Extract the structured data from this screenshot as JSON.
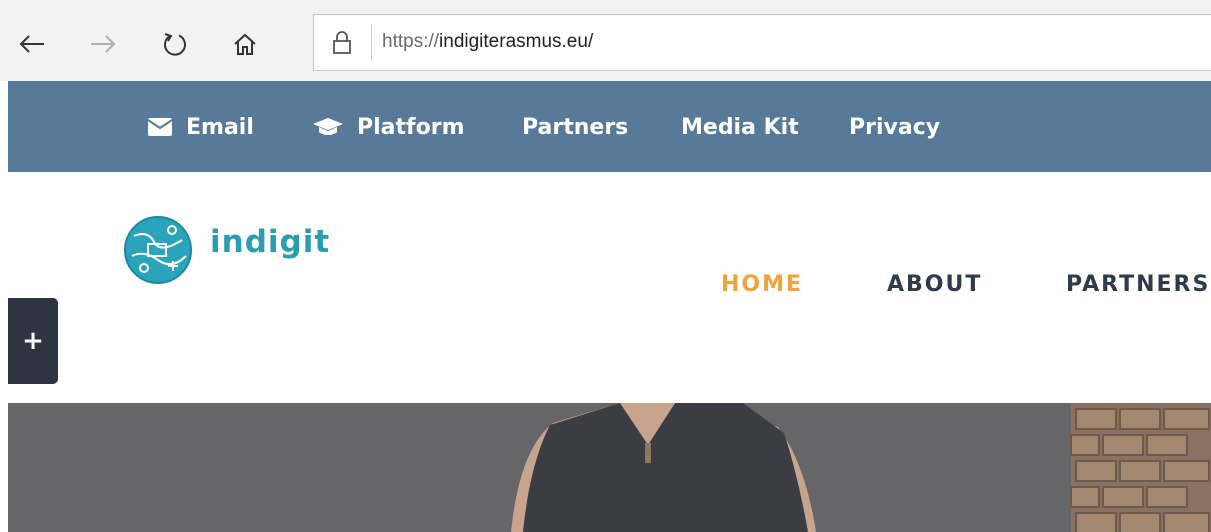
{
  "browser": {
    "url_scheme": "https://",
    "url_host": "indigiterasmus.eu/",
    "icons": [
      "back-arrow-icon",
      "forward-arrow-icon",
      "refresh-icon",
      "home-icon",
      "lock-icon"
    ]
  },
  "topbar": {
    "color": "#567a98",
    "items": [
      {
        "label": "Email",
        "icon": "envelope-icon"
      },
      {
        "label": "Platform",
        "icon": "graduation-cap-icon"
      },
      {
        "label": "Partners"
      },
      {
        "label": "Media Kit"
      },
      {
        "label": "Privacy"
      }
    ]
  },
  "header": {
    "brand": "indigit",
    "brand_color": "#2a9db3",
    "menu": [
      {
        "label": "HOME",
        "active": true
      },
      {
        "label": "ABOUT"
      },
      {
        "label": "PARTNERS"
      }
    ],
    "active_color": "#f0a23c"
  },
  "side_toggle": {
    "label": "+"
  }
}
